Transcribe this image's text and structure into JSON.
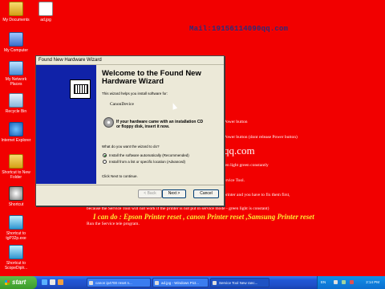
{
  "desktop_icons": [
    {
      "label": "My Documents",
      "icon": "folder-icon"
    },
    {
      "label": "ad.jpg",
      "icon": "image-file-icon"
    },
    {
      "label": "My Computer",
      "icon": "computer-icon"
    },
    {
      "label": "My Network Places",
      "icon": "network-icon"
    },
    {
      "label": "Recycle Bin",
      "icon": "recycle-bin-icon"
    },
    {
      "label": "Internet Explorer",
      "icon": "internet-explorer-icon"
    },
    {
      "label": "Shortcut to New Folder",
      "icon": "folder-shortcut-icon"
    },
    {
      "label": "Shortcut",
      "icon": "tool-shortcut-icon"
    },
    {
      "label": "Shortcut to tgP32p.exe",
      "icon": "exe-shortcut-icon"
    },
    {
      "label": "Shortcut to ScopeDiplr...",
      "icon": "exe-shortcut-icon"
    }
  ],
  "background": {
    "mail": "Mail:19156114090qq.com",
    "lines": [
      "Power button",
      "Power button (dont release Power button)",
      "ten light green constantly",
      "ervice Tool.",
      "printer and you have to fix them first,",
      "because the Service Tool will not work if the printer is not put in service mode - green light is constant)",
      "Run the Service tele program."
    ],
    "qq": "qq.com",
    "yellow_line": "I can do : Epson Printer reset , canon Printer reset ,Samsung Printer reset"
  },
  "wizard": {
    "window_title": "Found New Hardware Wizard",
    "heading": "Welcome to the Found New Hardware Wizard",
    "helps_text": "This wizard helps you install software for:",
    "device": "CanonDevice",
    "cd_text_1": "If your hardware came with an installation CD",
    "cd_text_2": "or floppy disk, insert it now.",
    "question": "What do you want the wizard to do?",
    "option_auto": "Install the software automatically (Recommended)",
    "option_list": "Install from a list or specific location (Advanced)",
    "click_next": "Click Next to continue.",
    "back": "< Back",
    "next": "Next >",
    "cancel": "Cancel"
  },
  "taskbar": {
    "start": "start",
    "items": [
      "canon ip4700 reset n...",
      "ad.jpg - Windows Pict...",
      "Service Tool New ranc..."
    ],
    "tray_text": "EN",
    "clock": "2:14 PM"
  }
}
